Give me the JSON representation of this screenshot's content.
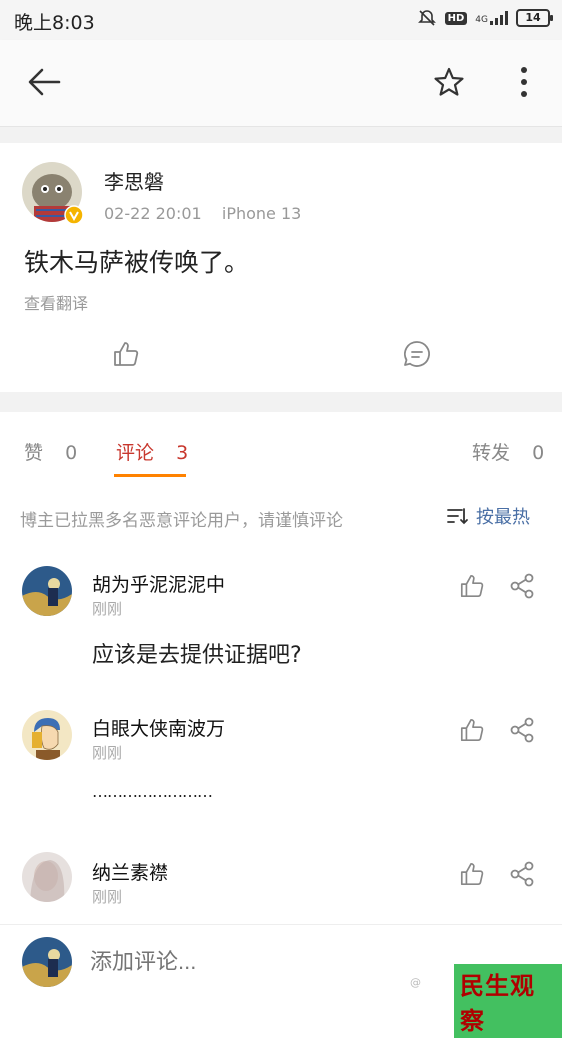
{
  "status_bar": {
    "time": "晚上8:03",
    "hd": "HD",
    "network": "4G",
    "battery": "14",
    "icons": [
      "mute-icon",
      "hd-icon",
      "signal-icon",
      "battery-icon"
    ]
  },
  "app_bar": {
    "icons": [
      "back-arrow-icon",
      "star-icon",
      "more-vert-icon"
    ]
  },
  "post": {
    "author": "李思磐",
    "time": "02-22 20:01",
    "device": "iPhone 13",
    "text": "铁木马萨被传唤了。",
    "translate": "查看翻译",
    "verified_color": "#f5b400"
  },
  "tabs": {
    "like_label": "赞",
    "like_count": "0",
    "comment_label": "评论",
    "comment_count": "3",
    "repost_label": "转发",
    "repost_count": "0",
    "active_color": "#c8372d",
    "underline_color": "#ff8200"
  },
  "notice": "博主已拉黑多名恶意评论用户，请谨慎评论",
  "sort_label": "按最热",
  "comments": [
    {
      "name": "胡为乎泥泥泥中",
      "time": "刚刚",
      "text": "应该是去提供证据吧?"
    },
    {
      "name": "白眼大侠南波万",
      "time": "刚刚",
      "text": "……………………"
    },
    {
      "name": "纳兰素襟",
      "time": "刚刚",
      "text": ""
    }
  ],
  "input_placeholder": "添加评论...",
  "watermark": "民生观察",
  "watermark_small": "@"
}
